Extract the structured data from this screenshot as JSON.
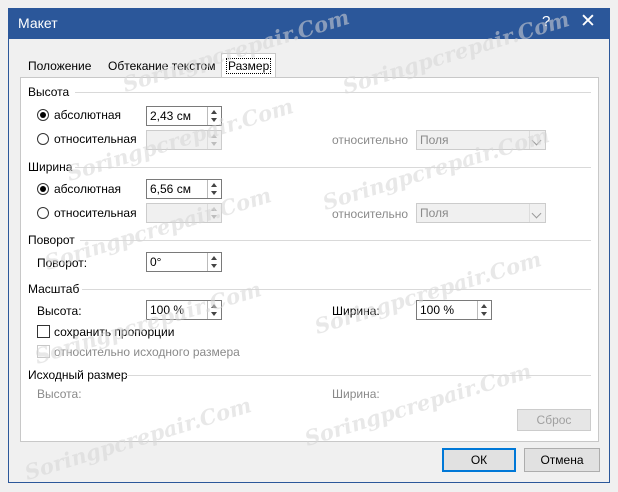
{
  "window": {
    "title": "Макет",
    "help": "?",
    "close": "✕"
  },
  "tabs": [
    {
      "label": "Положение",
      "active": false
    },
    {
      "label": "Обтекание текстом",
      "active": false
    },
    {
      "label": "Размер",
      "active": true
    }
  ],
  "height": {
    "section": "Высота",
    "absolute_label": "абсолютная",
    "absolute_value": "2,43 см",
    "relative_label": "относительная",
    "relative_to_label": "относительно",
    "relative_to_value": "Поля"
  },
  "width": {
    "section": "Ширина",
    "absolute_label": "абсолютная",
    "absolute_value": "6,56 см",
    "relative_label": "относительная",
    "relative_to_label": "относительно",
    "relative_to_value": "Поля"
  },
  "rotation": {
    "section": "Поворот",
    "label": "Поворот:",
    "value": "0°"
  },
  "scale": {
    "section": "Масштаб",
    "height_label": "Высота:",
    "height_value": "100 %",
    "width_label": "Ширина:",
    "width_value": "100 %",
    "lock_label": "сохранить пропорции",
    "relative_original_label": "относительно исходного размера"
  },
  "original": {
    "section": "Исходный размер",
    "height_label": "Высота:",
    "width_label": "Ширина:",
    "reset_label": "Сброс"
  },
  "buttons": {
    "ok": "ОК",
    "cancel": "Отмена"
  },
  "watermark": "Soringpcrepair.Com",
  "colors": {
    "titlebar": "#2b579a",
    "default_button_border": "#0078d7"
  }
}
